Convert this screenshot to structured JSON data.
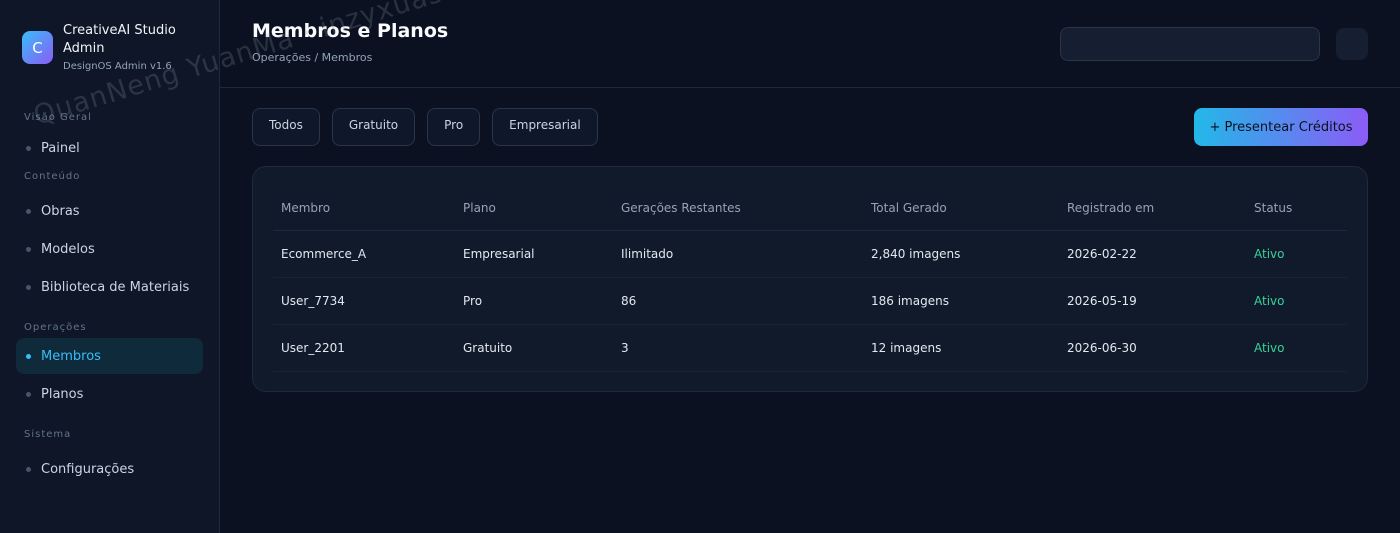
{
  "brand": {
    "logo_letter": "C",
    "name": "CreativeAI Studio Admin",
    "subtitle": "DesignOS Admin v1.6"
  },
  "sidebar": {
    "sections": [
      {
        "title": "Visão Geral",
        "items": [
          {
            "label": "Painel",
            "active": false
          }
        ]
      },
      {
        "title": "Conteúdo",
        "items": [
          {
            "label": "Obras",
            "active": false
          },
          {
            "label": "Modelos",
            "active": false
          },
          {
            "label": "Biblioteca de Materiais",
            "active": false
          }
        ]
      },
      {
        "title": "Operações",
        "items": [
          {
            "label": "Membros",
            "active": true
          },
          {
            "label": "Planos",
            "active": false
          }
        ]
      },
      {
        "title": "Sistema",
        "items": [
          {
            "label": "Configurações",
            "active": false
          }
        ]
      }
    ]
  },
  "header": {
    "title": "Membros e Planos",
    "breadcrumb": "Operações / Membros",
    "search_value": ""
  },
  "filters": [
    "Todos",
    "Gratuito",
    "Pro",
    "Empresarial"
  ],
  "actions": {
    "gift_label": "+ Presentear Créditos"
  },
  "table": {
    "columns": [
      "Membro",
      "Plano",
      "Gerações Restantes",
      "Total Gerado",
      "Registrado em",
      "Status"
    ],
    "rows": [
      [
        "Ecommerce_A",
        "Empresarial",
        "Ilimitado",
        "2,840 imagens",
        "2026-02-22",
        "Ativo"
      ],
      [
        "User_7734",
        "Pro",
        "86",
        "186 imagens",
        "2026-05-19",
        "Ativo"
      ],
      [
        "User_2201",
        "Gratuito",
        "3",
        "12 imagens",
        "2026-06-30",
        "Ativo"
      ]
    ]
  },
  "watermark": "QuanNeng YuanMa · inzyxuashop.com",
  "colors": {
    "background": "#0b1120",
    "sidebar": "#0e1627",
    "accent": "#38bdf8",
    "status_active": "#34d399",
    "gradient_start": "#22b8e8",
    "gradient_end": "#8b5cf6"
  }
}
